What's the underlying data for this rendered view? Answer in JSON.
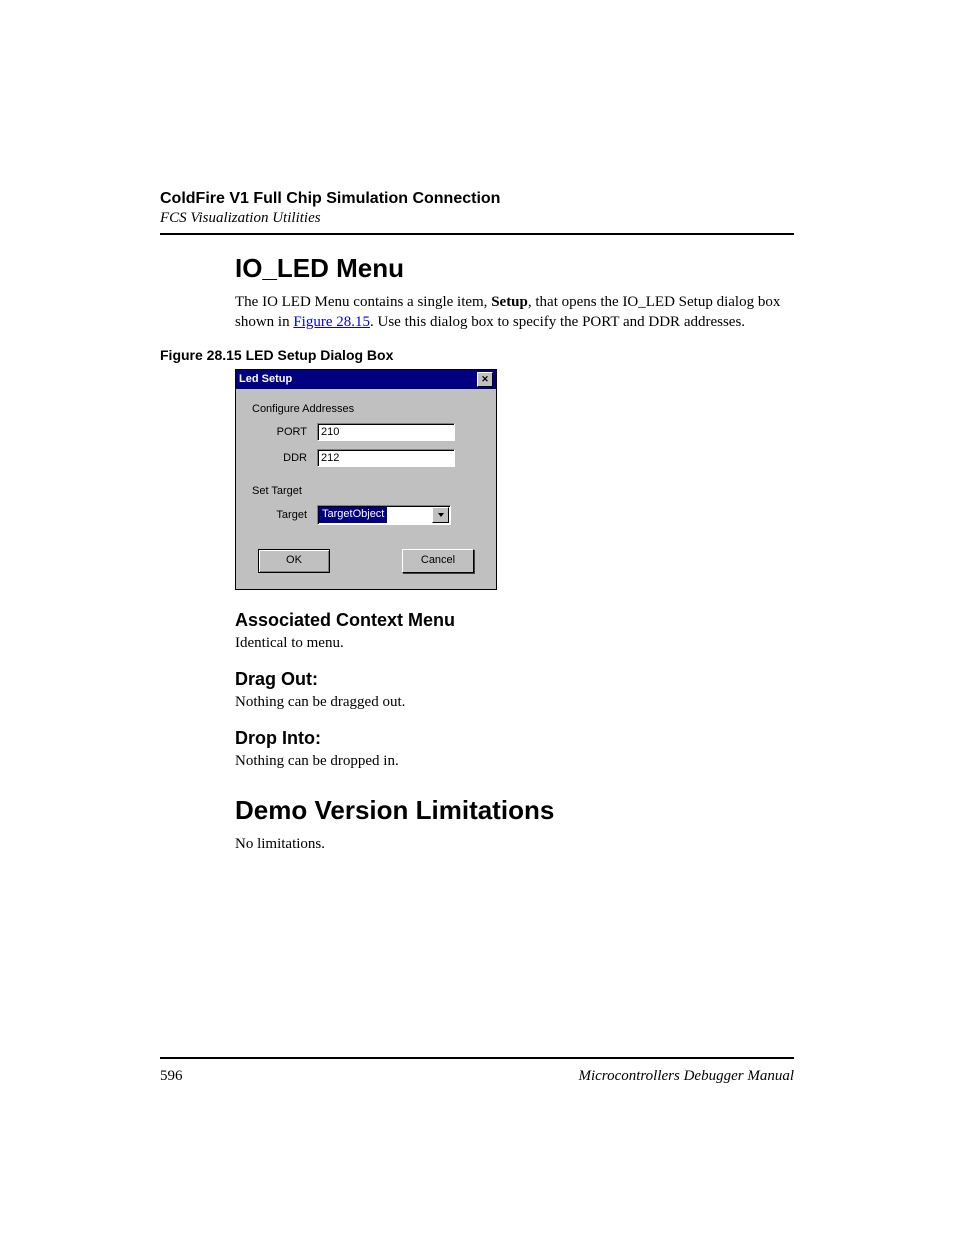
{
  "header": {
    "title": "ColdFire V1 Full Chip Simulation Connection",
    "subtitle": "FCS Visualization Utilities"
  },
  "section1": {
    "heading": "IO_LED Menu",
    "para_before": "The IO LED Menu contains a single item, ",
    "para_bold": "Setup",
    "para_mid": ", that opens the IO_LED Setup dialog box shown in ",
    "para_link": "Figure 28.15",
    "para_after": ". Use this dialog box to specify the PORT and DDR addresses."
  },
  "figure": {
    "caption": "Figure 28.15  LED Setup Dialog Box"
  },
  "dialog": {
    "title": "Led Setup",
    "group1_label": "Configure Addresses",
    "port_label": "PORT",
    "port_value": "210",
    "ddr_label": "DDR",
    "ddr_value": "212",
    "group2_label": "Set Target",
    "target_label": "Target",
    "target_value": "TargetObject",
    "ok": "OK",
    "cancel": "Cancel"
  },
  "sub1": {
    "heading": "Associated Context Menu",
    "text": "Identical to menu."
  },
  "sub2": {
    "heading": "Drag Out:",
    "text": "Nothing can be dragged out."
  },
  "sub3": {
    "heading": "Drop Into:",
    "text": "Nothing can be dropped in."
  },
  "section2": {
    "heading": "Demo Version Limitations",
    "text": "No limitations."
  },
  "footer": {
    "page": "596",
    "manual": "Microcontrollers Debugger Manual"
  }
}
